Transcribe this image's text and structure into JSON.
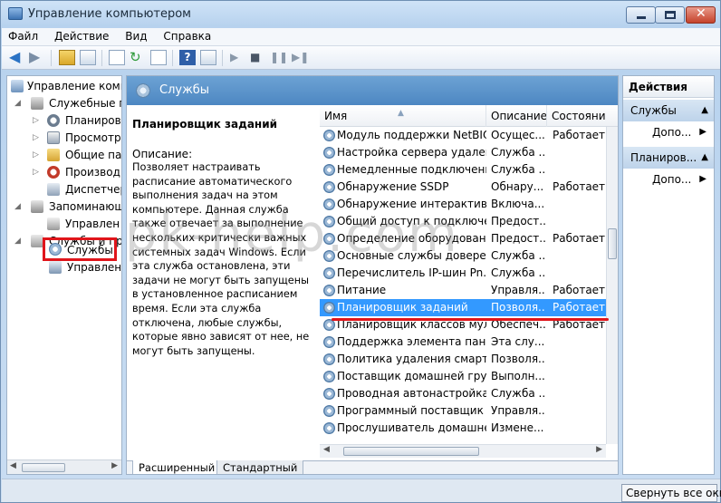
{
  "window": {
    "title": "Управление компьютером"
  },
  "menu": [
    "Файл",
    "Действие",
    "Вид",
    "Справка"
  ],
  "tree": [
    {
      "label": "Управление компь",
      "icon": "computer-management-icon"
    },
    {
      "label": "Служебные пр",
      "icon": "tools-icon"
    },
    {
      "label": "Планировщ",
      "icon": "clock-icon"
    },
    {
      "label": "Просмотр",
      "icon": "event-viewer-icon"
    },
    {
      "label": "Общие пап",
      "icon": "shared-folder-icon"
    },
    {
      "label": "Производ",
      "icon": "performance-icon"
    },
    {
      "label": "Диспетчер",
      "icon": "device-manager-icon"
    },
    {
      "label": "Запоминающ",
      "icon": "storage-icon"
    },
    {
      "label": "Управлен",
      "icon": "disk-management-icon"
    },
    {
      "label": "Службы и пр",
      "icon": "services-apps-icon"
    },
    {
      "label": "Службы",
      "icon": "services-gear-icon"
    },
    {
      "label": "Управлен",
      "icon": "wmi-icon"
    }
  ],
  "center": {
    "title": "Службы",
    "selected_service": "Планировщик заданий",
    "description_label": "Описание:",
    "description": "Позволяет настраивать расписание автоматического выполнения задач на этом компьютере. Данная служба также отвечает за выполнение нескольких критически важных системных задач Windows. Если эта служба остановлена, эти задачи не могут быть запущены в установленное расписанием время. Если эта служба отключена, любые службы, которые явно зависят от нее, не могут быть запущены."
  },
  "columns": {
    "name": "Имя",
    "description": "Описание",
    "state": "Состояни"
  },
  "services": [
    {
      "name": "Модуль поддержки NetBIO...",
      "description": "Осущес...",
      "state": "Работает"
    },
    {
      "name": "Настройка сервера удален...",
      "description": "Служба ...",
      "state": ""
    },
    {
      "name": "Немедленные подключени...",
      "description": "Служба ...",
      "state": ""
    },
    {
      "name": "Обнаружение SSDP",
      "description": "Обнару...",
      "state": "Работает"
    },
    {
      "name": "Обнаружение интерактивн...",
      "description": "Включа...",
      "state": ""
    },
    {
      "name": "Общий доступ к подключе...",
      "description": "Предост...",
      "state": ""
    },
    {
      "name": "Определение оборудовани...",
      "description": "Предост...",
      "state": "Работает"
    },
    {
      "name": "Основные службы довере...",
      "description": "Служба ...",
      "state": ""
    },
    {
      "name": "Перечислитель IP-шин Pn...",
      "description": "Служба ...",
      "state": ""
    },
    {
      "name": "Питание",
      "description": "Управля...",
      "state": "Работает"
    },
    {
      "name": "Планировщик заданий",
      "description": "Позволя...",
      "state": "Работает",
      "selected": true
    },
    {
      "name": "Планировщик классов мул...",
      "description": "Обеспеч...",
      "state": "Работает"
    },
    {
      "name": "Поддержка элемента пане...",
      "description": "Эта слу...",
      "state": ""
    },
    {
      "name": "Политика удаления смарт-...",
      "description": "Позволя...",
      "state": ""
    },
    {
      "name": "Поставщик домашней гру...",
      "description": "Выполн...",
      "state": ""
    },
    {
      "name": "Проводная автонастройка",
      "description": "Служба ...",
      "state": ""
    },
    {
      "name": "Программный поставщик ...",
      "description": "Управля...",
      "state": ""
    },
    {
      "name": "Прослушиватель домашне...",
      "description": "Измене...",
      "state": ""
    }
  ],
  "tabs": {
    "extended": "Расширенный",
    "standard": "Стандартный"
  },
  "actions": {
    "title": "Действия",
    "group1": "Службы",
    "more1": "Допо...",
    "group2": "Планиров...",
    "more2": "Допо..."
  },
  "taskbar": {
    "collapse_all": "Свернуть все окна"
  },
  "watermark": "pk-help.com",
  "colors": {
    "selection": "#3399ff",
    "highlight": "#e0151b",
    "header": "#4d87c2"
  }
}
